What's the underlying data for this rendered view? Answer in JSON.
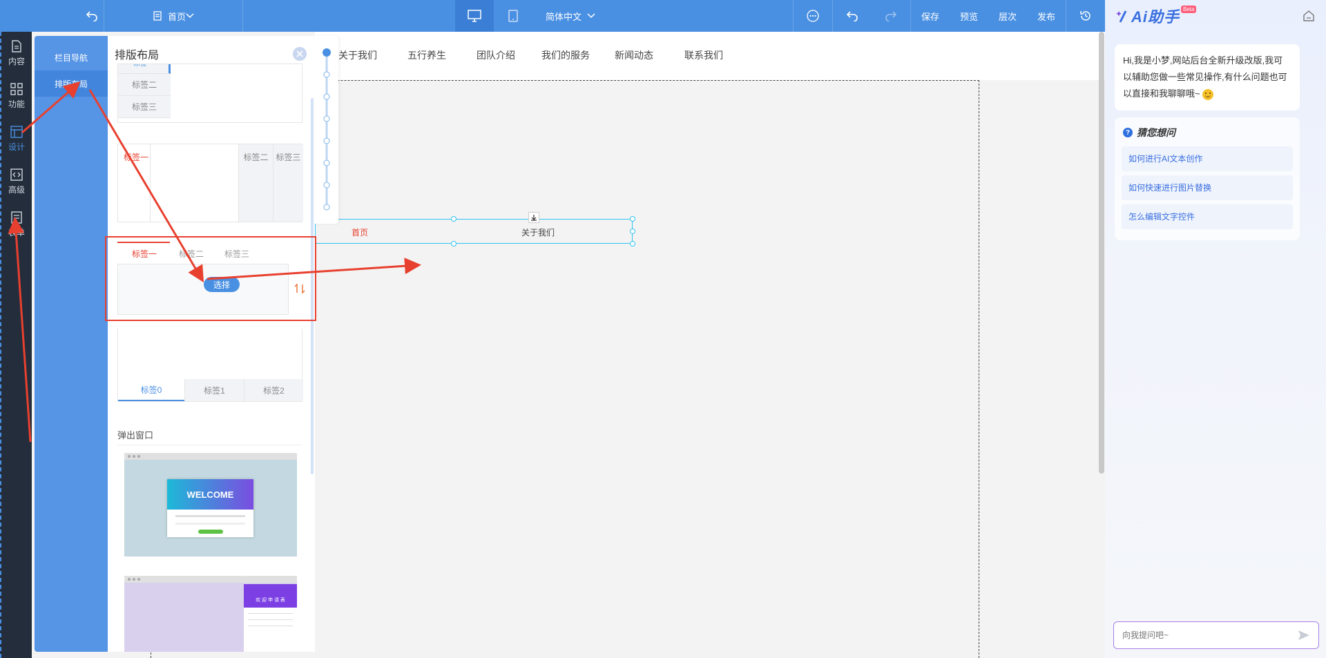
{
  "toolbar": {
    "page_name": "首页",
    "language": "简体中文",
    "save_label": "保存",
    "preview_label": "预览",
    "layers_label": "层次",
    "publish_label": "发布"
  },
  "iconbar": {
    "items": [
      {
        "label": "内容",
        "icon": "document-icon"
      },
      {
        "label": "功能",
        "icon": "grid-icon"
      },
      {
        "label": "设计",
        "icon": "layout-icon"
      },
      {
        "label": "高级",
        "icon": "code-box-icon"
      },
      {
        "label": "表单",
        "icon": "form-icon"
      }
    ]
  },
  "nav2": {
    "items": [
      {
        "label": "栏目导航"
      },
      {
        "label": "排版布局"
      }
    ]
  },
  "panel": {
    "title": "排版布局",
    "vertical_tabs": [
      "标签一",
      "标签二",
      "标签三"
    ],
    "horizontal_tabs": [
      "标签一",
      "标签二",
      "标签三"
    ],
    "selected_tabs": [
      "标签一",
      "标签二",
      "标签三"
    ],
    "choose_label": "选择",
    "bottom_tabs": [
      "标签0",
      "标签1",
      "标签2"
    ],
    "popup_section": "弹出窗口",
    "welcome_title": "WELCOME",
    "popup2_title": "欢 迎 申 请 表"
  },
  "site": {
    "nav_items": [
      "关于我们",
      "五行养生",
      "团队介绍",
      "我们的服务",
      "新闻动态",
      "联系我们"
    ],
    "selected_home": "首页",
    "selected_about": "关于我们"
  },
  "ai": {
    "title": "Ai助手",
    "beta": "Beta",
    "greeting": "Hi,我是小梦,网站后台全新升级改版,我可以辅助您做一些常见操作,有什么问题也可以直接和我聊聊哦~",
    "guess_title": "猜您想问",
    "questions": [
      "如何进行AI文本创作",
      "如何快速进行图片替换",
      "怎么编辑文字控件"
    ],
    "input_placeholder": "向我提问吧~"
  },
  "colors": {
    "toolbar": "#4a90e2",
    "accent_red": "#e8402f",
    "ai_blue": "#3a6fe0"
  }
}
